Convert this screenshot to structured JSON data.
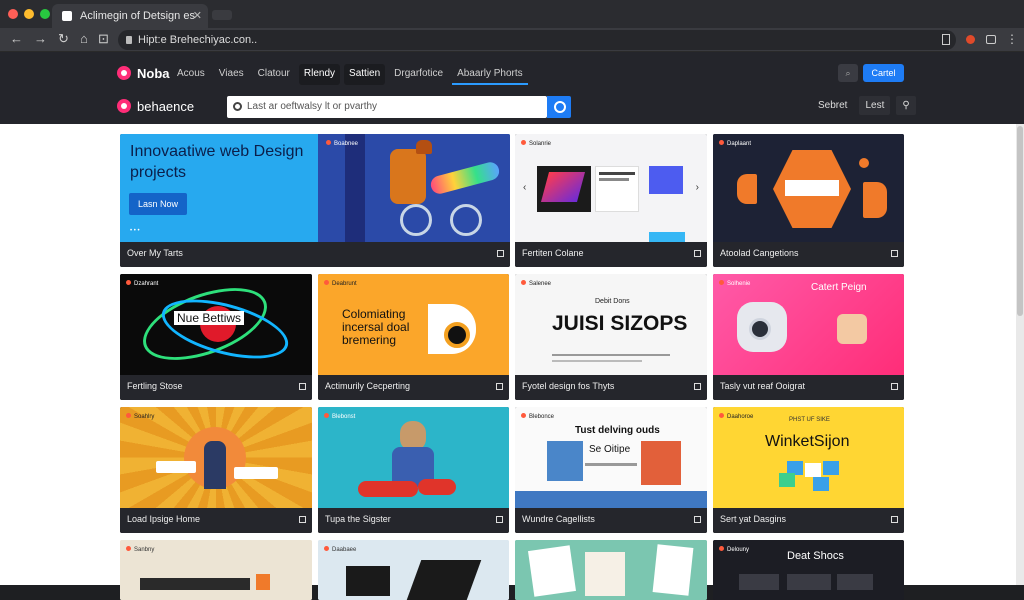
{
  "browser": {
    "tab_title": "Aclimegin of Detsign es",
    "tab_close": "✕",
    "url": "Hipt:e Brehechiyac.con..",
    "nav": {
      "back": "←",
      "forward": "→",
      "reload": "↻",
      "home": "⌂",
      "extension": "⊡"
    }
  },
  "header": {
    "brand": "Noba",
    "nav": [
      "Acous",
      "Viaes",
      "Clatour",
      "Rlendy",
      "Sattien",
      "Drgarfotice",
      "Abaarly Phorts"
    ],
    "cta_ghost": "⌕",
    "cta_primary": "Cartel",
    "brand2": "behaence",
    "search_placeholder": "Last ar oeftwalsy lt or pvarthy",
    "right_links": [
      "Sebret",
      "Lest",
      "⚲"
    ]
  },
  "cards": [
    {
      "title": "Over My Tarts",
      "headline": "Innovaatiwe web Design projects",
      "button": "Lasn Now",
      "brand": "Boabnee"
    },
    {
      "title": "Fertiten Colane",
      "brand": "Solanrie"
    },
    {
      "title": "Atoolad Cangetions",
      "brand": "Daplaant"
    },
    {
      "title": "Fertling Stose",
      "art_text": "Nue Bettiws",
      "brand": "Dzahrant"
    },
    {
      "title": "Actimurily Cecperting",
      "art_text": "Colomiating incersal doal bremering",
      "brand": "Deabrunt"
    },
    {
      "title": "Fyotel design fos Thyts",
      "art_text": "JUISI SIZOPS",
      "art_sub": "Debit Dons",
      "brand": "Salenee"
    },
    {
      "title": "Tasly vut reaf Ooigrat",
      "art_text": "Catert Peign",
      "brand": "Solhenie"
    },
    {
      "title": "Load Ipsige Home",
      "brand": "Soahlry"
    },
    {
      "title": "Tupa the Sigster",
      "brand": "Blebonst"
    },
    {
      "title": "Wundre Cagellists",
      "art_text": "Tust delving ouds",
      "art_sub": "Se Oitipe",
      "brand": "Blebonce"
    },
    {
      "title": "Sert yat Dasgins",
      "art_text": "WinketSijon",
      "art_sub": "PHST UF SIKE",
      "brand": "Daahoroe"
    },
    {
      "title": "",
      "brand": "Sanbny"
    },
    {
      "title": "",
      "brand": "Daabaee"
    },
    {
      "title": "",
      "brand": ""
    },
    {
      "title": "",
      "art_text": "Deat Shocs",
      "brand": "Delouny"
    }
  ],
  "colors": {
    "accent": "#1e7cf5",
    "brand_pink": "#ff2d78",
    "header_bg": "#24252b"
  }
}
